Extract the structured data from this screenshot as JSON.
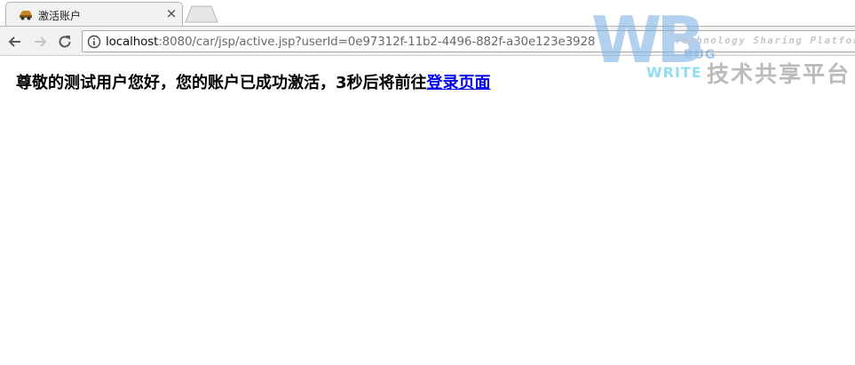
{
  "browser": {
    "tab": {
      "title": "激活账户",
      "close_glyph": "×"
    },
    "address": {
      "host": "localhost",
      "path": ":8080/car/jsp/active.jsp?userId=0e97312f-11b2-4496-882f-a30e123e3928"
    },
    "icons": [
      "car-favicon-icon",
      "close-icon",
      "back-arrow-icon",
      "forward-arrow-icon",
      "reload-icon",
      "info-icon"
    ]
  },
  "page": {
    "message": "尊敬的测试用户您好，您的账户已成功激活，3秒后将前往",
    "link_text": "登录页面"
  },
  "watermark": {
    "letters": "WB",
    "bug": "BUG",
    "write": "WRITE",
    "tagline": "Technology Sharing Platform",
    "chinese": "技术共享平台"
  },
  "colors": {
    "link": "#0000ee",
    "chrome_bg": "#f2f2f2"
  }
}
